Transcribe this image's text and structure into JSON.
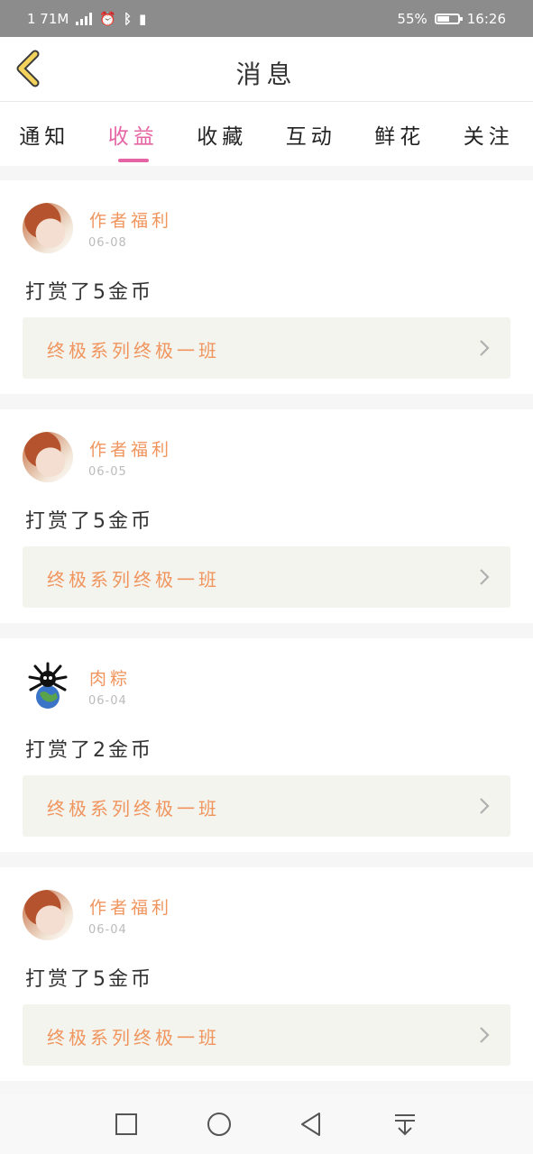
{
  "status_bar": {
    "carrier": "1 71M",
    "battery_percent": "55%",
    "battery_level": 0.55,
    "time": "16:26"
  },
  "header": {
    "title": "消息"
  },
  "tabs": [
    {
      "label": "通知",
      "active": false
    },
    {
      "label": "收益",
      "active": true
    },
    {
      "label": "收藏",
      "active": false
    },
    {
      "label": "互动",
      "active": false
    },
    {
      "label": "鲜花",
      "active": false
    },
    {
      "label": "关注",
      "active": false
    }
  ],
  "messages": [
    {
      "user": "作者福利",
      "date": "06-08",
      "text": "打赏了5金币",
      "book": "终极系列终极一班",
      "avatar": "anime-girl-avatar"
    },
    {
      "user": "作者福利",
      "date": "06-05",
      "text": "打赏了5金币",
      "book": "终极系列终极一班",
      "avatar": "anime-girl-avatar"
    },
    {
      "user": "肉粽",
      "date": "06-04",
      "text": "打赏了2金币",
      "book": "终极系列终极一班",
      "avatar": "bug-earth-avatar"
    },
    {
      "user": "作者福利",
      "date": "06-04",
      "text": "打赏了5金币",
      "book": "终极系列终极一班",
      "avatar": "anime-girl-avatar"
    }
  ],
  "colors": {
    "accent_pink": "#e565a4",
    "accent_orange": "#f0955e",
    "back_yellow": "#f3d35c"
  },
  "nav_icons": [
    "square-icon",
    "circle-icon",
    "back-triangle-icon",
    "notification-pulldown-icon"
  ]
}
